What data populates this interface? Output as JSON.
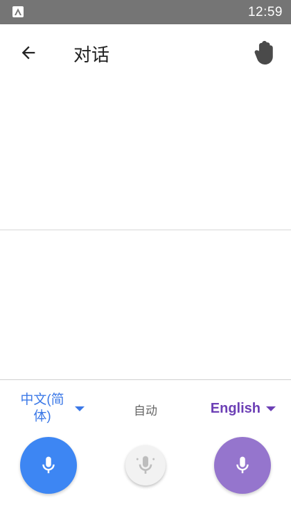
{
  "status_bar": {
    "time": "12:59",
    "app_icon": "launcher-a-icon"
  },
  "app_bar": {
    "title": "对话",
    "back_icon": "arrow-left-icon",
    "hand_icon": "hand-icon"
  },
  "languages": {
    "source": {
      "label": "中文(简体)",
      "color": "#3b78e7"
    },
    "auto": "自动",
    "target": {
      "label": "English",
      "color": "#6c3fb5"
    }
  },
  "mics": {
    "left": {
      "icon": "mic-icon",
      "color": "#3d86f3"
    },
    "center": {
      "icon": "auto-mic-icon",
      "color": "#f2f2f2"
    },
    "right": {
      "icon": "mic-icon",
      "color": "#9575cd"
    }
  }
}
